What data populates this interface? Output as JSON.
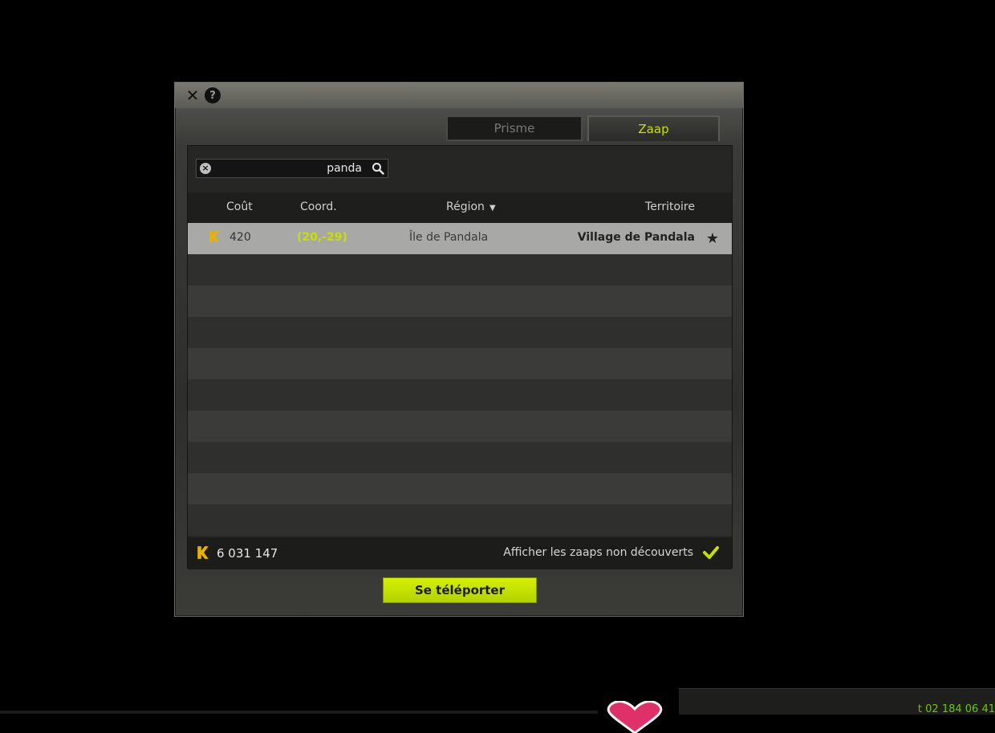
{
  "window": {
    "close_glyph": "✕",
    "help_glyph": "?"
  },
  "tabs": [
    {
      "label": "Prisme",
      "active": false
    },
    {
      "label": "Zaap",
      "active": true
    }
  ],
  "search": {
    "value": "panda",
    "clear_glyph": "×"
  },
  "table": {
    "headers": {
      "cost": "Coût",
      "coord": "Coord.",
      "region": "Région",
      "territory": "Territoire"
    },
    "sort_column": "region",
    "rows": [
      {
        "cost": "420",
        "coord": "(20,-29)",
        "region": "Île de Pandala",
        "territory": "Village de Pandala",
        "favorite": true,
        "selected": true
      }
    ]
  },
  "footer": {
    "kamas_total": "6 031 147",
    "show_undiscovered_label": "Afficher les zaaps non découverts",
    "show_undiscovered_checked": true
  },
  "teleport_button": "Se téléporter",
  "bottom_panel": {
    "text": "t 02 184 06 41"
  },
  "colors": {
    "accent": "#c6e000",
    "kamas_icon": "#e5b300",
    "background": "#000000"
  }
}
